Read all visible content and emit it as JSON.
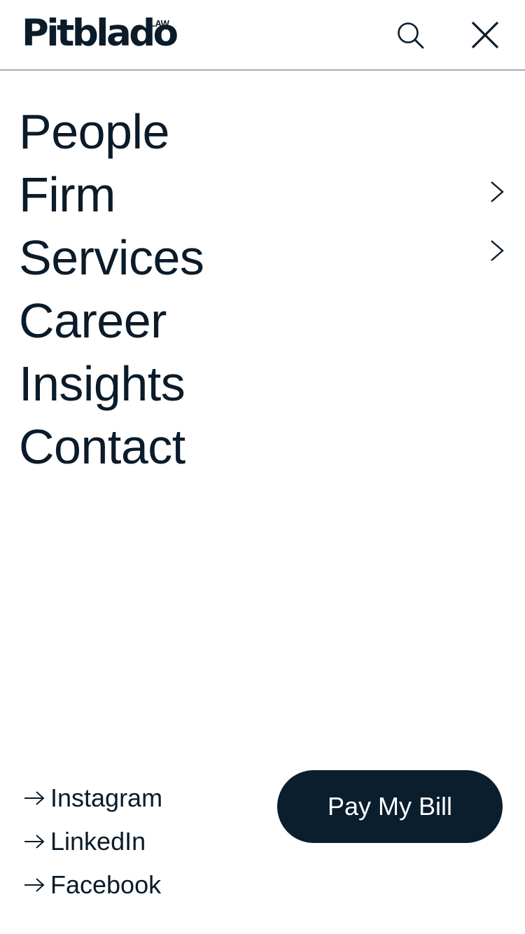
{
  "header": {
    "logo_text": "Pitblado",
    "logo_sup": "LAW",
    "search_icon": "search-icon",
    "close_icon": "close-icon"
  },
  "nav": {
    "items": [
      {
        "label": "People",
        "has_submenu": false
      },
      {
        "label": "Firm",
        "has_submenu": true
      },
      {
        "label": "Services",
        "has_submenu": true
      },
      {
        "label": "Career",
        "has_submenu": false
      },
      {
        "label": "Insights",
        "has_submenu": false
      },
      {
        "label": "Contact",
        "has_submenu": false
      }
    ]
  },
  "social": {
    "items": [
      {
        "label": "Instagram",
        "icon": "arrow-right-icon"
      },
      {
        "label": "LinkedIn",
        "icon": "arrow-right-icon"
      },
      {
        "label": "Facebook",
        "icon": "arrow-right-icon"
      }
    ]
  },
  "cta": {
    "pay_label": "Pay My Bill"
  },
  "colors": {
    "text": "#0b1b29",
    "button_bg": "#0b1e2d",
    "divider": "#a8abad",
    "background": "#ffffff"
  }
}
